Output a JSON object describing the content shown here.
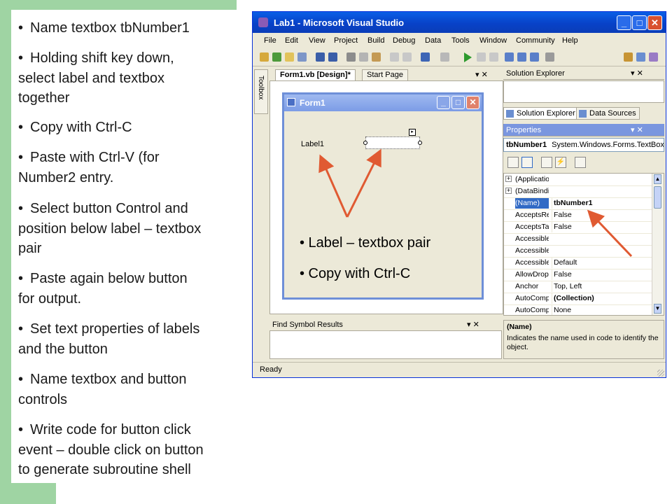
{
  "slide": {
    "bullets": [
      {
        "bullet": "•",
        "lines": [
          "Name textbox tbNumber1"
        ]
      },
      {
        "bullet": "•",
        "lines": [
          "Holding shift key down,",
          "select label and textbox",
          "together"
        ]
      },
      {
        "bullet": "•",
        "lines": [
          "Copy with Ctrl-C"
        ]
      },
      {
        "bullet": "•",
        "lines": [
          "Paste with Ctrl-V (for",
          "Number2 entry."
        ]
      },
      {
        "bullet": "•",
        "lines": [
          "Select button Control and",
          "position below label – textbox",
          "pair"
        ]
      },
      {
        "bullet": "•",
        "lines": [
          "Paste again below button",
          "for output."
        ]
      },
      {
        "bullet": "•",
        "lines": [
          "Set text properties of labels",
          "and the button"
        ]
      },
      {
        "bullet": "•",
        "lines": [
          "Name textbox and button",
          "controls"
        ]
      },
      {
        "bullet": "•",
        "lines": [
          "Write code for button click",
          "event – double click on button",
          "to generate subroutine shell"
        ]
      }
    ],
    "callouts": [
      "• Label – textbox pair",
      "• Copy with Ctrl-C"
    ],
    "accent_green": "#9fd4a3",
    "arrow_color": "#e05a32"
  },
  "vs": {
    "title": "Lab1 - Microsoft Visual Studio",
    "window_buttons": {
      "minimize": "_",
      "maximize": "□",
      "close": "✕"
    },
    "menu": [
      "File",
      "Edit",
      "View",
      "Project",
      "Build",
      "Debug",
      "Data",
      "Tools",
      "Window",
      "Community",
      "Help"
    ],
    "toolbox_label": "Toolbox",
    "doc_tabs": [
      "Form1.vb [Design]*",
      "Start Page"
    ],
    "doc_tab_controls": "▾ ✕",
    "form": {
      "title": "Form1",
      "buttons": {
        "minimize": "_",
        "maximize": "□",
        "close": "✕"
      },
      "label_text": "Label1",
      "smart_tag": "▸"
    },
    "solution_explorer": {
      "title": "Solution Explorer",
      "controls": "▾ ✕",
      "tabs": [
        "Solution Explorer",
        "Data Sources"
      ]
    },
    "properties": {
      "title": "Properties",
      "controls": "▾ ✕",
      "object_name": "tbNumber1",
      "object_type": "System.Windows.Forms.TextBox",
      "rows": [
        {
          "expand": "+",
          "name": "(Applicatio",
          "value": "",
          "bold": false,
          "selected": false
        },
        {
          "expand": "+",
          "name": "(DataBindir",
          "value": "",
          "bold": false,
          "selected": false
        },
        {
          "expand": "",
          "name": "(Name)",
          "value": "tbNumber1",
          "bold": true,
          "selected": true
        },
        {
          "expand": "",
          "name": "AcceptsRe",
          "value": "False",
          "bold": false,
          "selected": false
        },
        {
          "expand": "",
          "name": "AcceptsTa",
          "value": "False",
          "bold": false,
          "selected": false
        },
        {
          "expand": "",
          "name": "Accessible",
          "value": "",
          "bold": false,
          "selected": false
        },
        {
          "expand": "",
          "name": "Accessible",
          "value": "",
          "bold": false,
          "selected": false
        },
        {
          "expand": "",
          "name": "Accessible",
          "value": "Default",
          "bold": false,
          "selected": false
        },
        {
          "expand": "",
          "name": "AllowDrop",
          "value": "False",
          "bold": false,
          "selected": false
        },
        {
          "expand": "",
          "name": "Anchor",
          "value": "Top, Left",
          "bold": false,
          "selected": false
        },
        {
          "expand": "",
          "name": "AutoComp",
          "value": "(Collection)",
          "bold": true,
          "selected": false
        },
        {
          "expand": "",
          "name": "AutoComp",
          "value": "None",
          "bold": false,
          "selected": false
        }
      ],
      "desc_name": "(Name)",
      "desc_text": "Indicates the name used in code to identify the object."
    },
    "find_symbol": {
      "title": "Find Symbol Results",
      "controls": "▾ ✕"
    },
    "status": "Ready"
  }
}
